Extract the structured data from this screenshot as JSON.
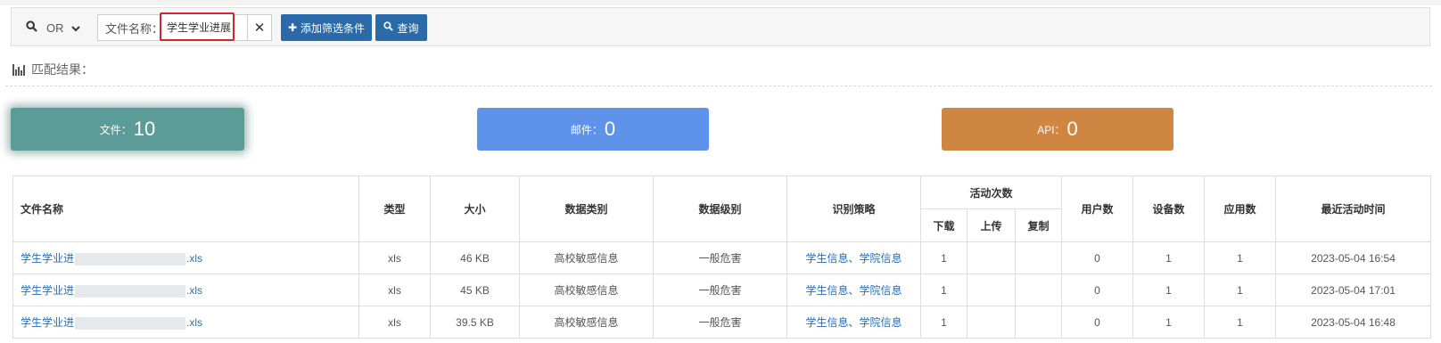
{
  "filter": {
    "logic_value": "OR",
    "condition_label": "文件名称：",
    "condition_value": "学生学业进展",
    "add_button": "添加筛选条件",
    "query_button": "查询"
  },
  "match_label": "匹配结果：",
  "cards": {
    "file": {
      "label": "文件：",
      "count": "10"
    },
    "mail": {
      "label": "邮件：",
      "count": "0"
    },
    "api": {
      "label": "API：",
      "count": "0"
    }
  },
  "table": {
    "headers": {
      "name": "文件名称",
      "type": "类型",
      "size": "大小",
      "data_category": "数据类别",
      "data_level": "数据级别",
      "strategy": "识别策略",
      "activity": "活动次数",
      "download": "下载",
      "upload": "上传",
      "copy": "复制",
      "users": "用户数",
      "devices": "设备数",
      "apps": "应用数",
      "last_time": "最近活动时间"
    },
    "rows": [
      {
        "name_prefix": "学生学业进",
        "name_suffix": ".xls",
        "type": "xls",
        "size": "46 KB",
        "category": "高校敏感信息",
        "level": "一般危害",
        "strategy": "学生信息、学院信息",
        "download": "1",
        "upload": "",
        "copy": "",
        "users": "0",
        "devices": "1",
        "apps": "1",
        "time": "2023-05-04 16:54"
      },
      {
        "name_prefix": "学生学业进",
        "name_suffix": ".xls",
        "type": "xls",
        "size": "45 KB",
        "category": "高校敏感信息",
        "level": "一般危害",
        "strategy": "学生信息、学院信息",
        "download": "1",
        "upload": "",
        "copy": "",
        "users": "0",
        "devices": "1",
        "apps": "1",
        "time": "2023-05-04 17:01"
      },
      {
        "name_prefix": "学生学业进",
        "name_suffix": ".xls",
        "type": "xls",
        "size": "39.5 KB",
        "category": "高校敏感信息",
        "level": "一般危害",
        "strategy": "学生信息、学院信息",
        "download": "1",
        "upload": "",
        "copy": "",
        "users": "0",
        "devices": "1",
        "apps": "1",
        "time": "2023-05-04 16:48"
      }
    ]
  },
  "colors": {
    "card_file": "#5b9c98",
    "card_mail": "#5f93e9",
    "card_api": "#cf8642",
    "button": "#2b6aa8",
    "link": "#2a6fb4",
    "highlight_border": "#d4252b"
  }
}
